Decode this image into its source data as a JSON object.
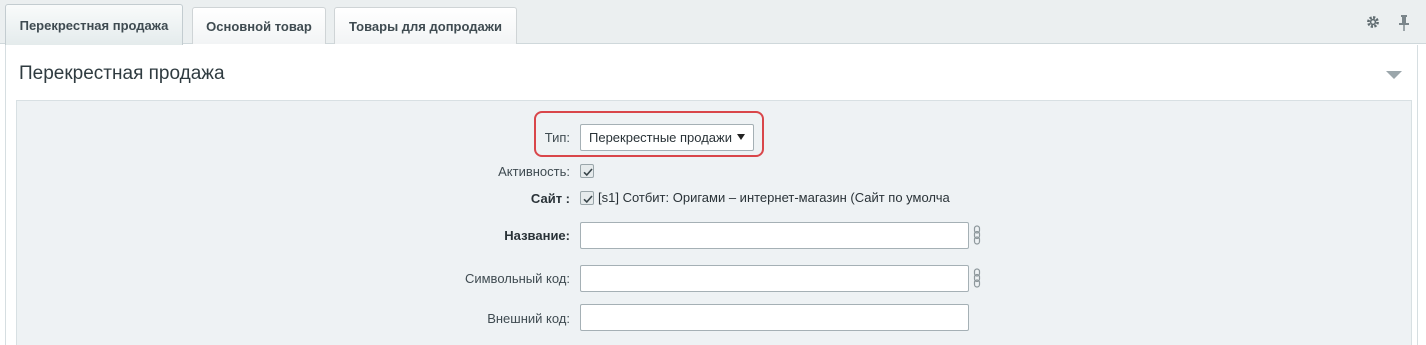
{
  "tabs": [
    {
      "label": "Перекрестная продажа",
      "active": true
    },
    {
      "label": "Основной товар",
      "active": false
    },
    {
      "label": "Товары для допродажи",
      "active": false
    }
  ],
  "toolbar": {
    "settings_icon": "gear-icon",
    "pin_icon": "pin-icon"
  },
  "panel": {
    "title": "Перекрестная продажа"
  },
  "form": {
    "type_label": "Тип:",
    "type_value": "Перекрестные продажи",
    "active_label": "Активность:",
    "active_checked": true,
    "site_label": "Сайт :",
    "site_checked": true,
    "site_value": "[s1] Сотбит: Оригами – интернет-магазин (Сайт по умолча",
    "name_label": "Название:",
    "name_value": "",
    "code_label": "Символьный код:",
    "code_value": "",
    "xml_label": "Внешний код:",
    "xml_value": ""
  },
  "colors": {
    "highlight": "#d9464a",
    "form_bg": "#eef2f4",
    "tabbar_bg": "#ebeff0"
  }
}
